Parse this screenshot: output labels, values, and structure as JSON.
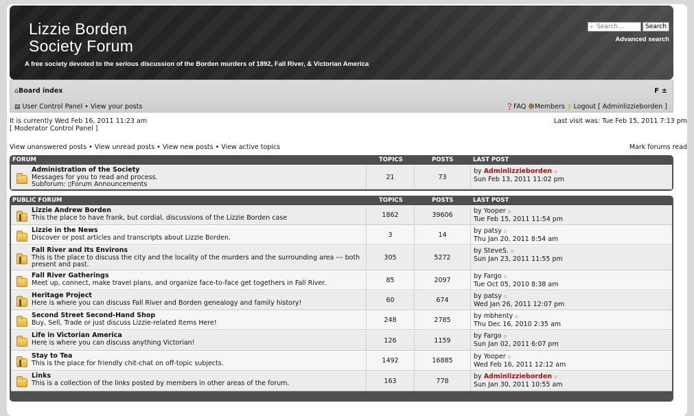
{
  "header": {
    "title_line1": "Lizzie Borden",
    "title_line2": "Society Forum",
    "description": "A free society devoted to the serious discussion of the Borden murders of 1892, Fall River, & Victorian America",
    "search_placeholder": "Search…",
    "search_button": "Search",
    "advanced_search": "Advanced search"
  },
  "nav": {
    "board_index": "Board index",
    "font_control": "F ±",
    "user_control_panel": "User Control Panel",
    "view_posts": "View your posts",
    "faq": "FAQ",
    "members": "Members",
    "logout": "Logout [ Adminlizzieborden ]",
    "sep": "•"
  },
  "info": {
    "current_time": "It is currently Wed Feb 16, 2011 11:23 am",
    "mod_panel": "[ Moderator Control Panel ]",
    "last_visit": "Last visit was: Tue Feb 15, 2011 7:13 pm",
    "view_unanswered": "View unanswered posts",
    "view_unread": "View unread posts",
    "view_new": "View new posts",
    "view_active": "View active topics",
    "mark_read": "Mark forums read"
  },
  "columns": {
    "topics": "TOPICS",
    "posts": "POSTS",
    "last_post": "LAST POST"
  },
  "categories": [
    {
      "name": "FORUM",
      "forums": [
        {
          "name": "Administration of the Society",
          "desc": "Messages for you to read and process.",
          "subforum": "Subforum: ▯Forum Announcements",
          "topics": "21",
          "posts": "73",
          "by": "by",
          "author": "Adminlizzieborden",
          "admin": true,
          "date": "Sun Feb 13, 2011 11:02 pm"
        }
      ]
    },
    {
      "name": "PUBLIC FORUM",
      "forums": [
        {
          "name": "Lizzie Andrew Borden",
          "desc": "This the place to have frank, but cordial, discussions of the Lizzie Borden case",
          "topics": "1862",
          "posts": "39606",
          "by": "by",
          "author": "Yooper",
          "date": "Tue Feb 15, 2011 11:54 pm",
          "locked": true
        },
        {
          "name": "Lizzie in the News",
          "desc": "Discover or post articles and transcripts about Lizzie Borden.",
          "topics": "3",
          "posts": "14",
          "by": "by",
          "author": "patsy",
          "date": "Thu Jan 20, 2011 8:54 am"
        },
        {
          "name": "Fall River and Its Environs",
          "desc": "This is the place to discuss the city and the locality of the murders and the surrounding area --- both present and past.",
          "topics": "305",
          "posts": "5272",
          "by": "by",
          "author": "SteveS.",
          "date": "Sun Jan 23, 2011 11:55 pm",
          "locked": true
        },
        {
          "name": "Fall River Gatherings",
          "desc": "Meet up, connect, make travel plans, and organize face-to-face get togethers in Fall River.",
          "topics": "85",
          "posts": "2097",
          "by": "by",
          "author": "Fargo",
          "date": "Tue Oct 05, 2010 8:38 am"
        },
        {
          "name": "Heritage Project",
          "desc": "Here is where you can discuss Fall River and Borden genealogy and family history!",
          "topics": "60",
          "posts": "674",
          "by": "by",
          "author": "patsy",
          "date": "Wed Jan 26, 2011 12:07 pm",
          "locked": true
        },
        {
          "name": "Second Street Second-Hand Shop",
          "desc": "Buy, Sell, Trade or just discuss Lizzie-related Items Here!",
          "topics": "248",
          "posts": "2785",
          "by": "by",
          "author": "mbhenty",
          "date": "Thu Dec 16, 2010 2:35 am"
        },
        {
          "name": "Life in Victorian America",
          "desc": "Here is where you can discuss anything Victorian!",
          "topics": "126",
          "posts": "1159",
          "by": "by",
          "author": "Fargo",
          "date": "Sun Jan 02, 2011 6:07 pm"
        },
        {
          "name": "Stay to Tea",
          "desc": "This is the place for friendly chit-chat on off-topic subjects.",
          "topics": "1492",
          "posts": "16885",
          "by": "by",
          "author": "Yooper",
          "date": "Wed Feb 16, 2011 12:12 am",
          "locked": true
        },
        {
          "name": "Links",
          "desc": "This is a collection of the links posted by members in other areas of the forum.",
          "topics": "163",
          "posts": "778",
          "by": "by",
          "author": "Adminlizzieborden",
          "admin": true,
          "date": "Sun Jan 30, 2011 10:55 am"
        }
      ]
    }
  ]
}
